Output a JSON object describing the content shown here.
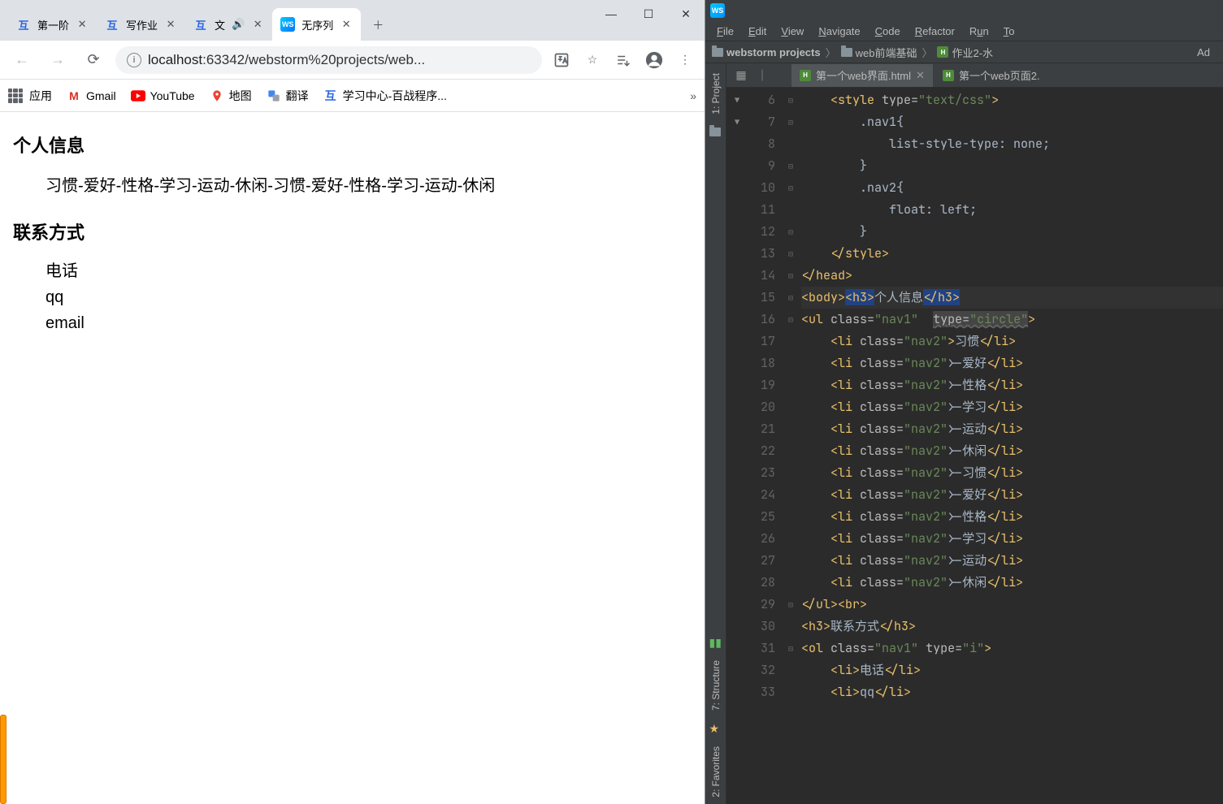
{
  "chrome": {
    "tabs": [
      {
        "title": "第一阶",
        "active": false
      },
      {
        "title": "写作业",
        "active": false
      },
      {
        "title": "文",
        "active": false,
        "audio": true
      },
      {
        "title": "无序列",
        "active": true
      }
    ],
    "address": {
      "host": "localhost",
      "rest": ":63342/webstorm%20projects/web..."
    },
    "bookmarks": {
      "apps": "应用",
      "items": [
        "Gmail",
        "YouTube",
        "地图",
        "翻译",
        "学习中心-百战程序..."
      ]
    },
    "page": {
      "h1": "个人信息",
      "horiz": "习惯-爱好-性格-学习-运动-休闲-习惯-爱好-性格-学习-运动-休闲",
      "h2": "联系方式",
      "vert": [
        "电话",
        "qq",
        "email"
      ]
    }
  },
  "ide": {
    "menu": [
      "File",
      "Edit",
      "View",
      "Navigate",
      "Code",
      "Refactor",
      "Run",
      "To"
    ],
    "crumbs": {
      "project": "webstorm projects",
      "folder": "web前端基础",
      "file": "作业2-水",
      "addbtn": "Ad"
    },
    "left_tabs": {
      "project": "1: Project",
      "structure": "7: Structure",
      "favorites": "2: Favorites"
    },
    "editor_tabs": [
      {
        "label": "第一个web界面.html",
        "active": true
      },
      {
        "label": "第一个web页面2.",
        "active": false
      }
    ],
    "lines": [
      6,
      7,
      8,
      9,
      10,
      11,
      12,
      13,
      14,
      15,
      16,
      17,
      18,
      19,
      20,
      21,
      22,
      23,
      24,
      25,
      26,
      27,
      28,
      29,
      30,
      31,
      32,
      33
    ],
    "code_text": {
      "l6": "<style type=\"text/css\">",
      "l7": ".nav1{",
      "l8": "list-style-type: none;",
      "l9": "}",
      "l10": ".nav2{",
      "l11": "float: left;",
      "l12": "}",
      "l13": "</style>",
      "l14": "</head>",
      "l15_body": "<body>",
      "l15_h3o": "<h3>",
      "l15_txt": "个人信息",
      "l15_h3c": "</h3>",
      "li_items": [
        "习惯",
        "-爱好",
        "-性格",
        "-学习",
        "-运动",
        "-休闲",
        "-习惯",
        "-爱好",
        "-性格",
        "-学习",
        "-运动",
        "-休闲"
      ],
      "l29": "</ul><br>",
      "l30": "<h3>联系方式</h3>",
      "l32": "<li>电话</li>",
      "l33": "<li>qq</li>"
    }
  }
}
